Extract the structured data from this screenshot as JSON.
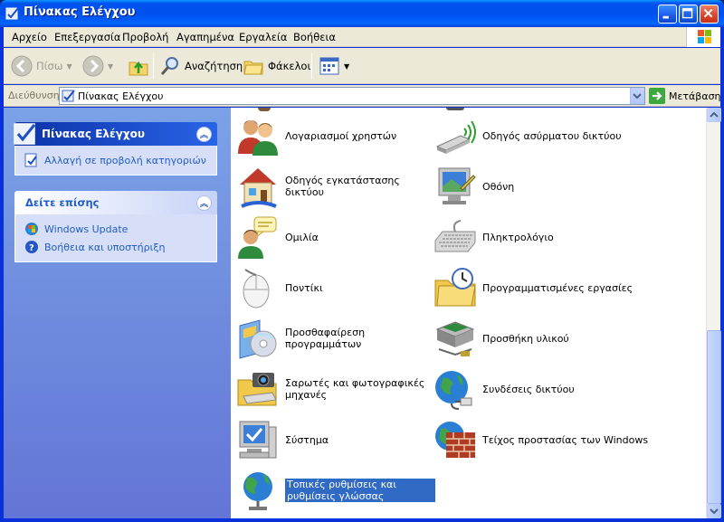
{
  "window": {
    "title": "Πίνακας Ελέγχου",
    "accent": "#0054e3"
  },
  "menu": [
    "Αρχείο",
    "Επεξεργασία",
    "Προβολή",
    "Αγαπημένα",
    "Εργαλεία",
    "Βοήθεια"
  ],
  "toolbar": {
    "back": "Πίσω",
    "search": "Αναζήτηση",
    "folders": "Φάκελοι"
  },
  "address": {
    "label": "Διεύθυνση",
    "value": "Πίνακας Ελέγχου",
    "go": "Μετάβαση"
  },
  "taskpane": {
    "control_panel": {
      "title": "Πίνακας Ελέγχου",
      "link": "Αλλαγή σε προβολή κατηγοριών"
    },
    "see_also": {
      "title": "Δείτε επίσης",
      "links": [
        "Windows Update",
        "Βοήθεια και υποστήριξη"
      ]
    }
  },
  "items": [
    {
      "label": "Λογαριασμοί χρηστών",
      "icon": "user-accounts-icon"
    },
    {
      "label": "Οδηγός ασύρματου δικτύου",
      "icon": "wireless-network-icon"
    },
    {
      "label": "Οδηγός εγκατάστασης δικτύου",
      "icon": "network-setup-icon"
    },
    {
      "label": "Οθόνη",
      "icon": "display-icon"
    },
    {
      "label": "Ομιλία",
      "icon": "speech-icon"
    },
    {
      "label": "Πληκτρολόγιο",
      "icon": "keyboard-icon"
    },
    {
      "label": "Ποντίκι",
      "icon": "mouse-icon"
    },
    {
      "label": "Προγραμματισμένες εργασίες",
      "icon": "scheduled-tasks-icon"
    },
    {
      "label": "Προσθαφαίρεση προγραμμάτων",
      "icon": "add-remove-programs-icon"
    },
    {
      "label": "Προσθήκη υλικού",
      "icon": "add-hardware-icon"
    },
    {
      "label": "Σαρωτές και φωτογραφικές μηχανές",
      "icon": "scanners-cameras-icon"
    },
    {
      "label": "Συνδέσεις δικτύου",
      "icon": "network-connections-icon"
    },
    {
      "label": "Σύστημα",
      "icon": "system-icon"
    },
    {
      "label": "Τείχος προστασίας των Windows",
      "icon": "firewall-icon"
    },
    {
      "label": "Τοπικές ρυθμίσεις και ρυθμίσεις γλώσσας",
      "icon": "regional-language-icon",
      "selected": true
    }
  ]
}
